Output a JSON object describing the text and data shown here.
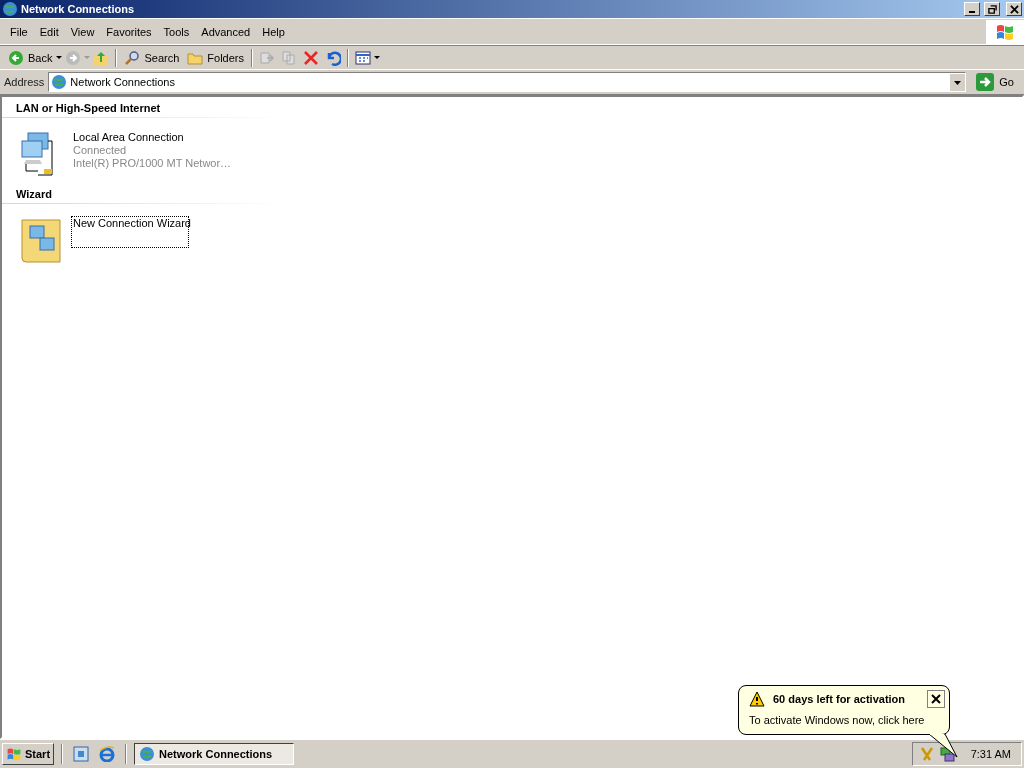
{
  "window": {
    "title": "Network Connections"
  },
  "menu": [
    "File",
    "Edit",
    "View",
    "Favorites",
    "Tools",
    "Advanced",
    "Help"
  ],
  "toolbar": {
    "back": "Back",
    "search": "Search",
    "folders": "Folders"
  },
  "address": {
    "label": "Address",
    "value": "Network Connections",
    "go": "Go"
  },
  "groups": [
    {
      "title": "LAN or High-Speed Internet",
      "items": [
        {
          "kind": "connection",
          "name": "Local Area Connection",
          "status": "Connected",
          "device": "Intel(R) PRO/1000 MT Networ…",
          "focused": false
        }
      ]
    },
    {
      "title": "Wizard",
      "items": [
        {
          "kind": "wizard",
          "name": "New Connection Wizard",
          "focused": true
        }
      ]
    }
  ],
  "balloon": {
    "title": "60 days left for activation",
    "text": "To activate Windows now, click here"
  },
  "taskbar": {
    "start": "Start",
    "tasks": [
      {
        "label": "Network Connections",
        "selected": true
      }
    ],
    "clock": "7:31 AM"
  }
}
